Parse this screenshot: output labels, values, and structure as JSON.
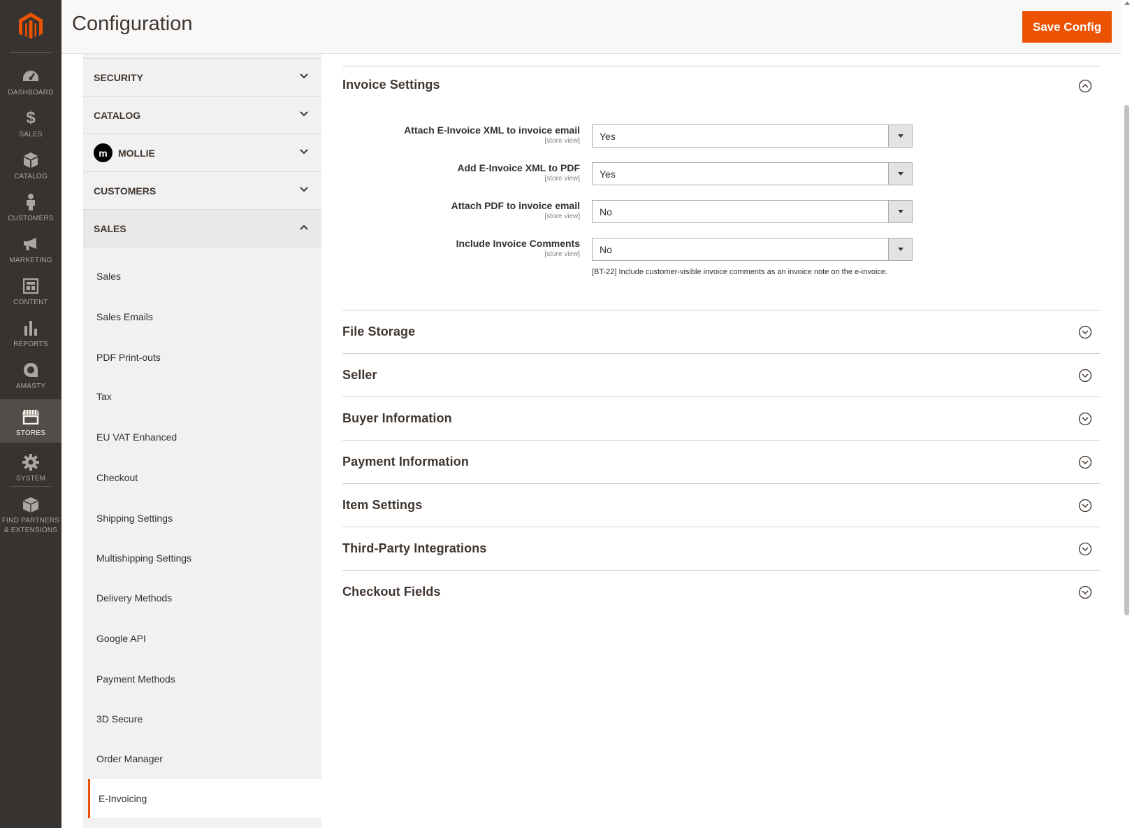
{
  "nav": {
    "items": [
      {
        "label": "DASHBOARD",
        "icon": "dashboard-icon"
      },
      {
        "label": "SALES",
        "icon": "dollar-icon"
      },
      {
        "label": "CATALOG",
        "icon": "box-icon"
      },
      {
        "label": "CUSTOMERS",
        "icon": "person-icon"
      },
      {
        "label": "MARKETING",
        "icon": "megaphone-icon"
      },
      {
        "label": "CONTENT",
        "icon": "layout-icon"
      },
      {
        "label": "REPORTS",
        "icon": "bar-chart-icon"
      },
      {
        "label": "AMASTY",
        "icon": "amasty-icon"
      },
      {
        "label": "STORES",
        "icon": "store-icon"
      },
      {
        "label": "SYSTEM",
        "icon": "gear-icon"
      }
    ],
    "partners_line1": "FIND PARTNERS",
    "partners_line2": "& EXTENSIONS",
    "accent_color": "#eb5202"
  },
  "header": {
    "title": "Configuration",
    "save_label": "Save Config"
  },
  "tabs": {
    "security": "SECURITY",
    "catalog": "CATALOG",
    "mollie": "MOLLIE",
    "mollie_badge": "m",
    "customers": "CUSTOMERS",
    "sales": "SALES",
    "sales_items": [
      "Sales",
      "Sales Emails",
      "PDF Print-outs",
      "Tax",
      "EU VAT Enhanced",
      "Checkout",
      "Shipping Settings",
      "Multishipping Settings",
      "Delivery Methods",
      "Google API",
      "Payment Methods",
      "3D Secure",
      "Order Manager",
      "E-Invoicing"
    ]
  },
  "invoice_settings": {
    "title": "Invoice Settings",
    "scope": "[store view]",
    "fields": [
      {
        "label": "Attach E-Invoice XML to invoice email",
        "value": "Yes"
      },
      {
        "label": "Add E-Invoice XML to PDF",
        "value": "Yes"
      },
      {
        "label": "Attach PDF to invoice email",
        "value": "No"
      },
      {
        "label": "Include Invoice Comments",
        "value": "No"
      }
    ],
    "comments_note": "[BT-22] Include customer-visible invoice comments as an invoice note on the e-invoice."
  },
  "sections": [
    "File Storage",
    "Seller",
    "Buyer Information",
    "Payment Information",
    "Item Settings",
    "Third-Party Integrations",
    "Checkout Fields"
  ]
}
